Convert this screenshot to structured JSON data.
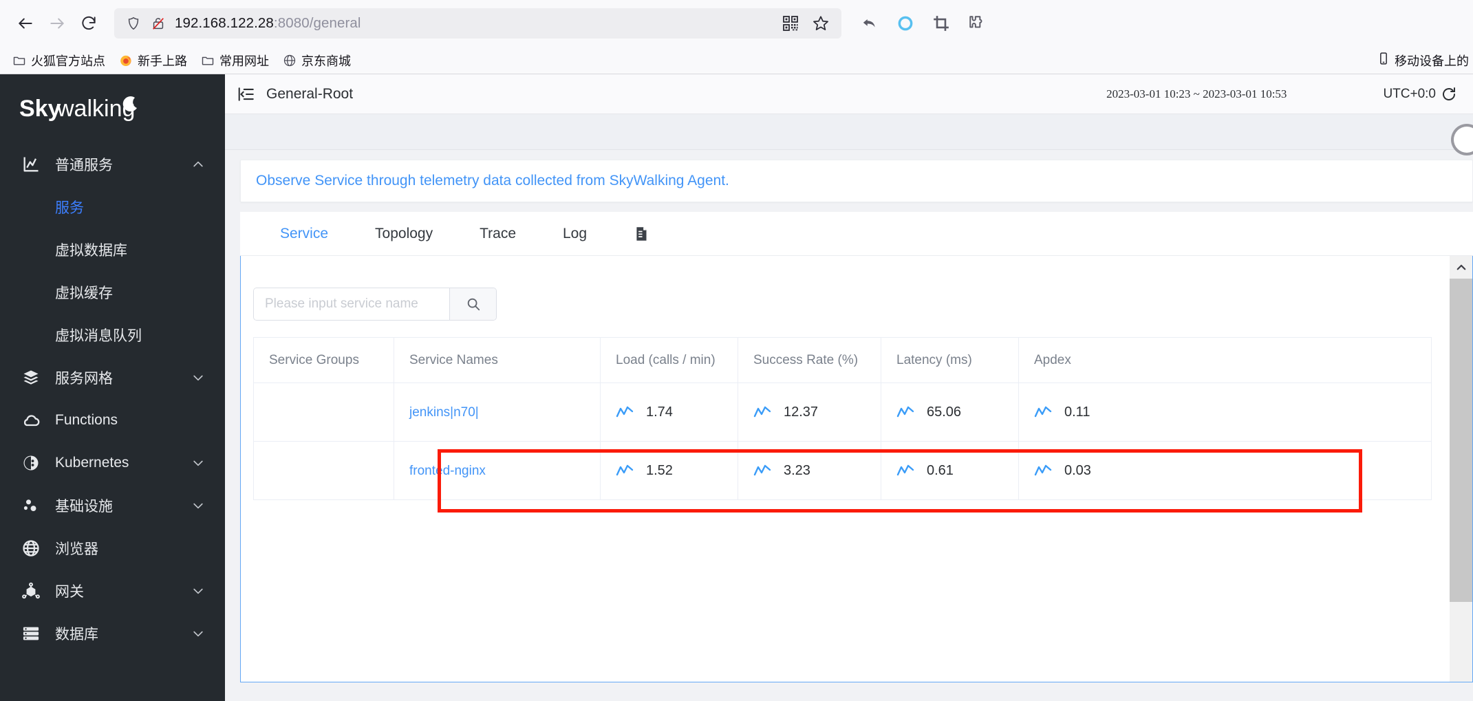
{
  "browser": {
    "back_label": "back-arrow",
    "forward_label": "forward-arrow",
    "reload_label": "reload",
    "url_host": "192.168.122.28",
    "url_rest": ":8080/general",
    "bookmarks": [
      {
        "label": "火狐官方站点",
        "icon": "folder-icon"
      },
      {
        "label": "新手上路",
        "icon": "firefox-icon"
      },
      {
        "label": "常用网址",
        "icon": "folder-icon"
      },
      {
        "label": "京东商城",
        "icon": "globe-icon"
      }
    ],
    "bookmarks_right": {
      "label": "移动设备上的",
      "icon": "mobile-icon"
    }
  },
  "sidebar": {
    "logo_text": "Skywalking",
    "items": [
      {
        "label": "普通服务",
        "icon": "chart-icon",
        "caret": "chevron-up",
        "expanded": true
      },
      {
        "label": "服务网格",
        "icon": "mesh-icon",
        "caret": "chevron-down",
        "expanded": false
      },
      {
        "label": "Functions",
        "icon": "cloud-icon",
        "caret": "",
        "expanded": false
      },
      {
        "label": "Kubernetes",
        "icon": "kubernetes-icon",
        "caret": "chevron-down",
        "expanded": false
      },
      {
        "label": "基础设施",
        "icon": "infrastructure-icon",
        "caret": "chevron-down",
        "expanded": false
      },
      {
        "label": "浏览器",
        "icon": "globe-icon",
        "caret": "",
        "expanded": false
      },
      {
        "label": "网关",
        "icon": "gateway-icon",
        "caret": "chevron-down",
        "expanded": false
      },
      {
        "label": "数据库",
        "icon": "database-icon",
        "caret": "chevron-down",
        "expanded": false
      }
    ],
    "sub_items": [
      {
        "label": "服务",
        "active": true
      },
      {
        "label": "虚拟数据库",
        "active": false
      },
      {
        "label": "虚拟缓存",
        "active": false
      },
      {
        "label": "虚拟消息队列",
        "active": false
      }
    ]
  },
  "topbar": {
    "collapse_icon": "collapse-sidebar-icon",
    "title": "General-Root",
    "time_range": "2023-03-01 10:23 ~ 2023-03-01 10:53",
    "timezone": "UTC+0:0",
    "refresh_icon": "refresh-icon"
  },
  "banner": {
    "text": "Observe Service through telemetry data collected from SkyWalking Agent."
  },
  "tabs": [
    {
      "label": "Service",
      "active": true
    },
    {
      "label": "Topology",
      "active": false
    },
    {
      "label": "Trace",
      "active": false
    },
    {
      "label": "Log",
      "active": false
    }
  ],
  "tabs_extra_icon": "copy-dashboard-icon",
  "search": {
    "placeholder": "Please input service name",
    "value": "",
    "button_icon": "search-icon"
  },
  "table": {
    "columns": [
      "Service Groups",
      "Service Names",
      "Load (calls / min)",
      "Success Rate (%)",
      "Latency (ms)",
      "Apdex"
    ],
    "rows": [
      {
        "group": "",
        "name": "jenkins|n70|",
        "load": "1.74",
        "success_rate": "12.37",
        "latency": "65.06",
        "apdex": "0.11",
        "highlighted": false
      },
      {
        "group": "",
        "name": "fronted-nginx",
        "load": "1.52",
        "success_rate": "3.23",
        "latency": "0.61",
        "apdex": "0.03",
        "highlighted": true
      }
    ]
  },
  "annotation": {
    "highlight_color": "#fb1b09",
    "target_row": "fronted-nginx"
  },
  "colors": {
    "accent": "#4294f7",
    "sidebar_bg": "#252a2f",
    "highlight": "#fb1b09"
  }
}
